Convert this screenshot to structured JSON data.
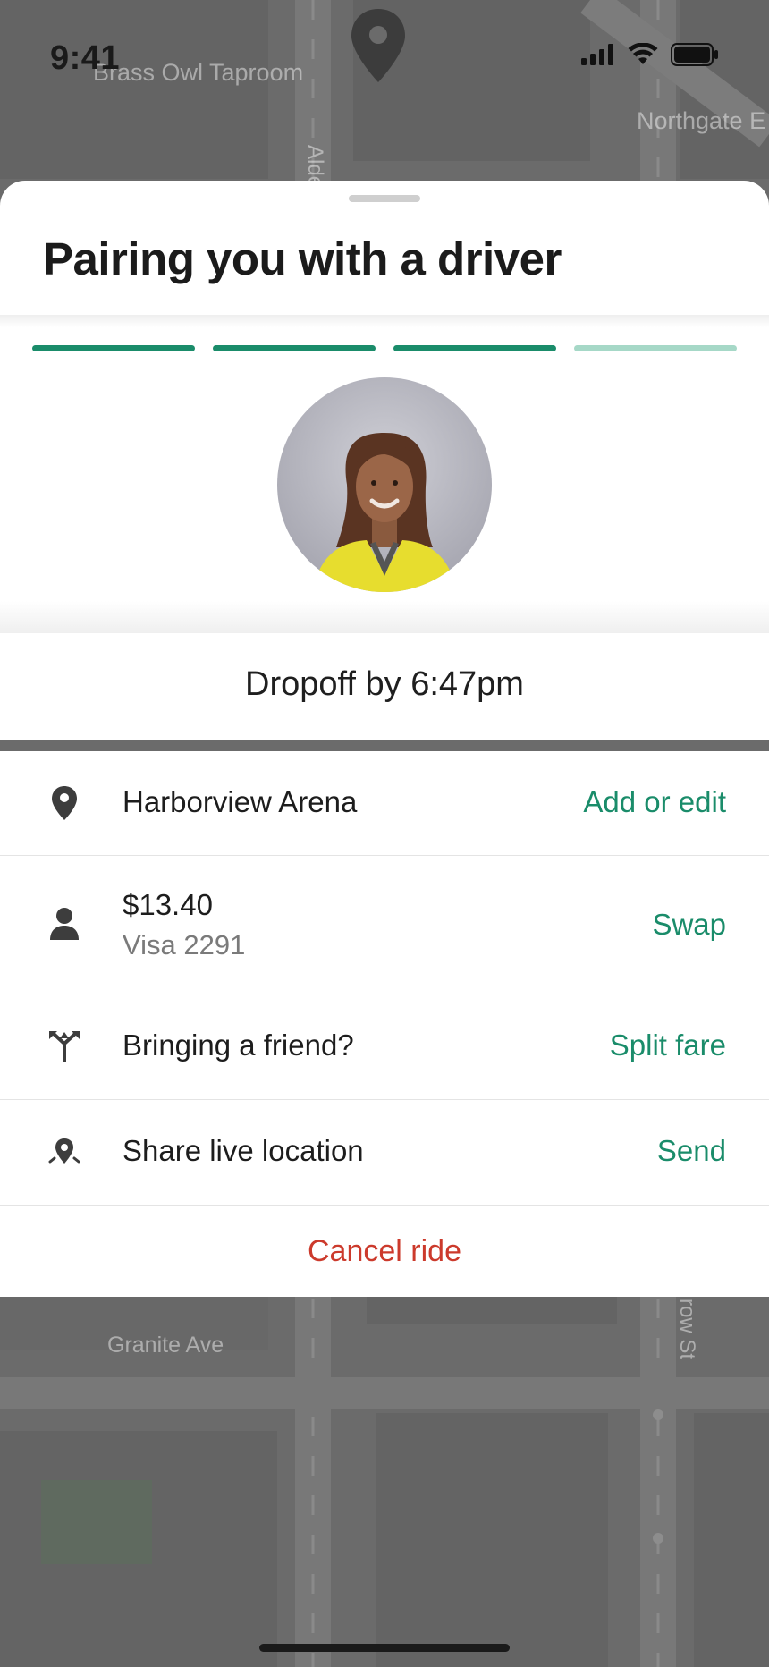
{
  "status_bar": {
    "time": "9:41",
    "icons": [
      "signal-icon",
      "wifi-icon",
      "battery-icon"
    ]
  },
  "map": {
    "labels": {
      "top_left": "Brass Owl Taproom",
      "top_right": "Northgate E",
      "street_vertical_top": "Alde",
      "bottom_left": "Granite Ave",
      "street_vertical_bottom": "row St"
    },
    "pin_icon": "map-pin-icon"
  },
  "sheet": {
    "title": "Pairing you with a driver",
    "progress": {
      "segments_total": 4,
      "segments_complete": 3
    },
    "avatar": "driver-avatar",
    "dropoff": "Dropoff by 6:47pm",
    "rows": [
      {
        "icon": "location-pin-icon",
        "label": "Harborview Arena",
        "action": "Add or edit"
      },
      {
        "icon": "person-icon",
        "label": "$13.40",
        "sublabel": "Visa 2291",
        "action": "Swap"
      },
      {
        "icon": "split-arrows-icon",
        "label": "Bringing a friend?",
        "action": "Split fare"
      },
      {
        "icon": "share-location-icon",
        "label": "Share live location",
        "action": "Send"
      }
    ],
    "cancel_label": "Cancel ride"
  },
  "colors": {
    "accent": "#1a8c6a",
    "accent_light": "#a6d8c7",
    "danger": "#cc3a2c",
    "map": "#6b6b6b"
  }
}
